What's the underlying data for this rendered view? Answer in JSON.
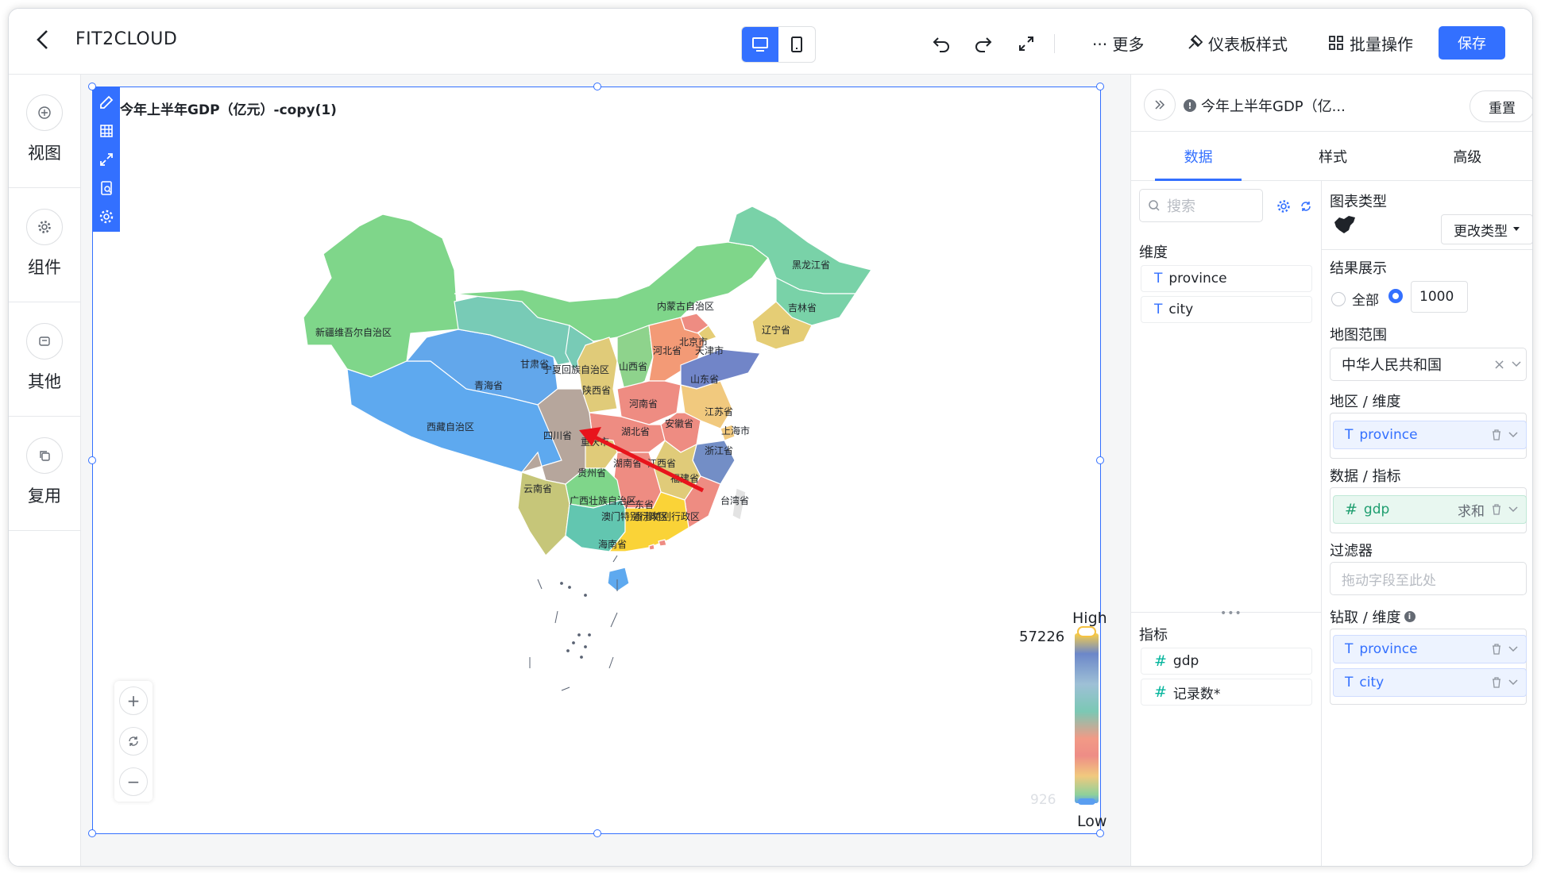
{
  "topbar": {
    "title": "FIT2CLOUD",
    "more_label": "··· 更多",
    "dashboard_style_label": "仪表板样式",
    "batch_label": "批量操作",
    "save_label": "保存"
  },
  "leftnav": {
    "items": [
      {
        "label": "视图",
        "icon": "plus-circle-icon"
      },
      {
        "label": "组件",
        "icon": "gear-icon"
      },
      {
        "label": "其他",
        "icon": "box-icon"
      },
      {
        "label": "复用",
        "icon": "copy-icon"
      }
    ]
  },
  "chart": {
    "title": "今年上半年GDP（亿元）-copy(1)",
    "legend_high": "High",
    "legend_low": "Low",
    "legend_max": "57226",
    "legend_min": "926",
    "highlight_color": "#fad337",
    "arrow_color": "#e8141c",
    "regions": [
      {
        "name": "黑龙江省",
        "color": "#79d2a8"
      },
      {
        "name": "吉林省",
        "color": "#79d2a8"
      },
      {
        "name": "辽宁省",
        "color": "#e5cd75"
      },
      {
        "name": "内蒙古自治区",
        "color": "#7fd68a"
      },
      {
        "name": "新疆维吾尔自治区",
        "color": "#7fd68a"
      },
      {
        "name": "甘肃省",
        "color": "#78cbb6"
      },
      {
        "name": "宁夏回族自治区",
        "color": "#78cbb6"
      },
      {
        "name": "山西省",
        "color": "#8ed38c"
      },
      {
        "name": "北京市",
        "color": "#ee8c82"
      },
      {
        "name": "河北省",
        "color": "#f39a76"
      },
      {
        "name": "天津市",
        "color": "#e5cd75"
      },
      {
        "name": "山东省",
        "color": "#7185c8"
      },
      {
        "name": "青海省",
        "color": "#62a7eb"
      },
      {
        "name": "陕西省",
        "color": "#e0cb79"
      },
      {
        "name": "河南省",
        "color": "#ee8c82"
      },
      {
        "name": "江苏省",
        "color": "#f1c97e"
      },
      {
        "name": "西藏自治区",
        "color": "#5ea9ef"
      },
      {
        "name": "四川省",
        "color": "#b6a69c"
      },
      {
        "name": "重庆市",
        "color": "#e0cb79"
      },
      {
        "name": "湖北省",
        "color": "#ee8c82"
      },
      {
        "name": "安徽省",
        "color": "#ee8c82"
      },
      {
        "name": "上海市",
        "color": "#f1c97e"
      },
      {
        "name": "浙江省",
        "color": "#738ec6"
      },
      {
        "name": "贵州省",
        "color": "#7fd68a"
      },
      {
        "name": "湖南省",
        "color": "#ee8c82"
      },
      {
        "name": "江西省",
        "color": "#e0cb79"
      },
      {
        "name": "福建省",
        "color": "#ee8c82"
      },
      {
        "name": "云南省",
        "color": "#c6c679"
      },
      {
        "name": "广西壮族自治区",
        "color": "#62c6b0"
      },
      {
        "name": "广东省",
        "color": "#fad337"
      },
      {
        "name": "台湾省",
        "color": "#e3e3e3"
      },
      {
        "name": "海南省",
        "color": "#5ea9ef"
      },
      {
        "name": "澳门特别行政区",
        "color": "#ee8c82"
      },
      {
        "name": "香港特别行政区",
        "color": "#ee8c82"
      }
    ]
  },
  "panel": {
    "chart_name": "今年上半年GDP（亿...",
    "reset_label": "重置",
    "tabs": [
      "数据",
      "样式",
      "高级"
    ],
    "search_placeholder": "搜索",
    "dimension_label": "维度",
    "dimensions": [
      "province",
      "city"
    ],
    "metric_label": "指标",
    "metrics": [
      "gdp",
      "记录数*"
    ],
    "chart_type_label": "图表类型",
    "change_type_label": "更改类型",
    "result_label": "结果展示",
    "result_all_label": "全部",
    "result_count": "1000",
    "map_range_label": "地图范围",
    "map_range_value": "中华人民共和国",
    "area_dim_label": "地区 / 维度",
    "area_dim_field": "province",
    "data_metric_label": "数据 / 指标",
    "data_metric_field": "gdp",
    "data_metric_agg": "求和",
    "filter_label": "过滤器",
    "filter_placeholder": "拖动字段至此处",
    "drill_label": "钻取 / 维度",
    "drill_fields": [
      "province",
      "city"
    ]
  }
}
